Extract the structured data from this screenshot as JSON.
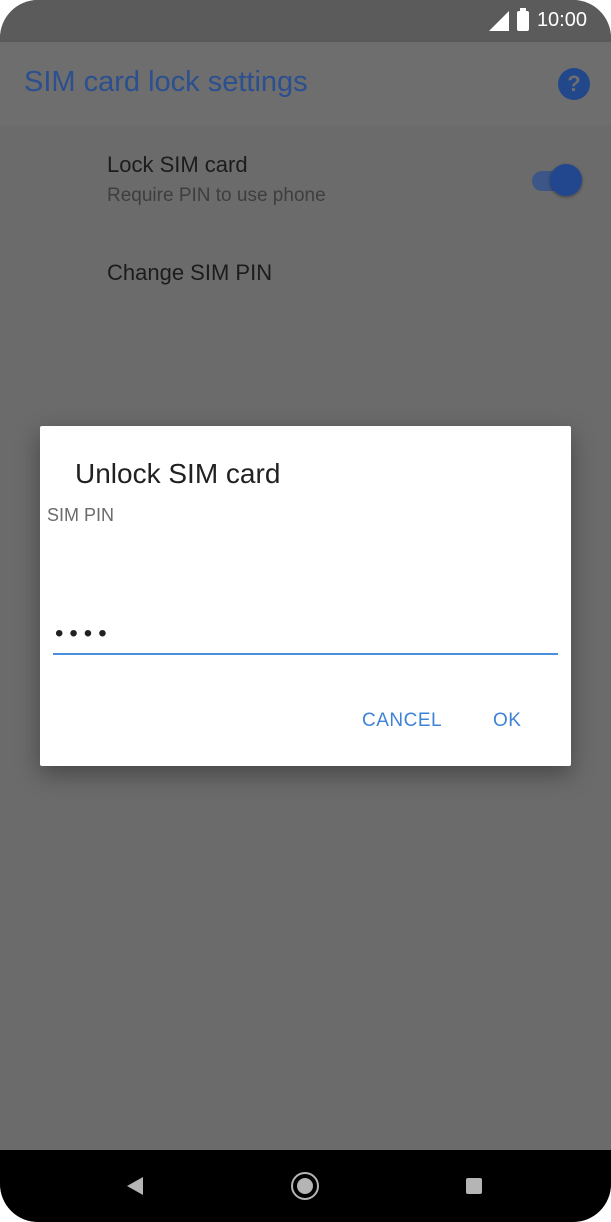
{
  "status_bar": {
    "time": "10:00",
    "icons": [
      "signal-icon",
      "battery-icon"
    ]
  },
  "app_bar": {
    "title": "SIM card lock settings",
    "help_icon": "help-icon",
    "help_glyph": "?"
  },
  "settings": {
    "lock_sim": {
      "title": "Lock SIM card",
      "subtitle": "Require PIN to use phone",
      "enabled": true
    },
    "change_pin": {
      "title": "Change SIM PIN"
    }
  },
  "dialog": {
    "title": "Unlock SIM card",
    "field_label": "SIM PIN",
    "pin_value": "••••",
    "cancel_label": "CANCEL",
    "ok_label": "OK"
  },
  "nav_bar": {
    "icons": [
      "back-icon",
      "home-icon",
      "recents-icon"
    ]
  },
  "colors": {
    "accent": "#3f83d6",
    "toolbar_title": "#2b4f8f",
    "scrim": "#6b6b6b"
  }
}
